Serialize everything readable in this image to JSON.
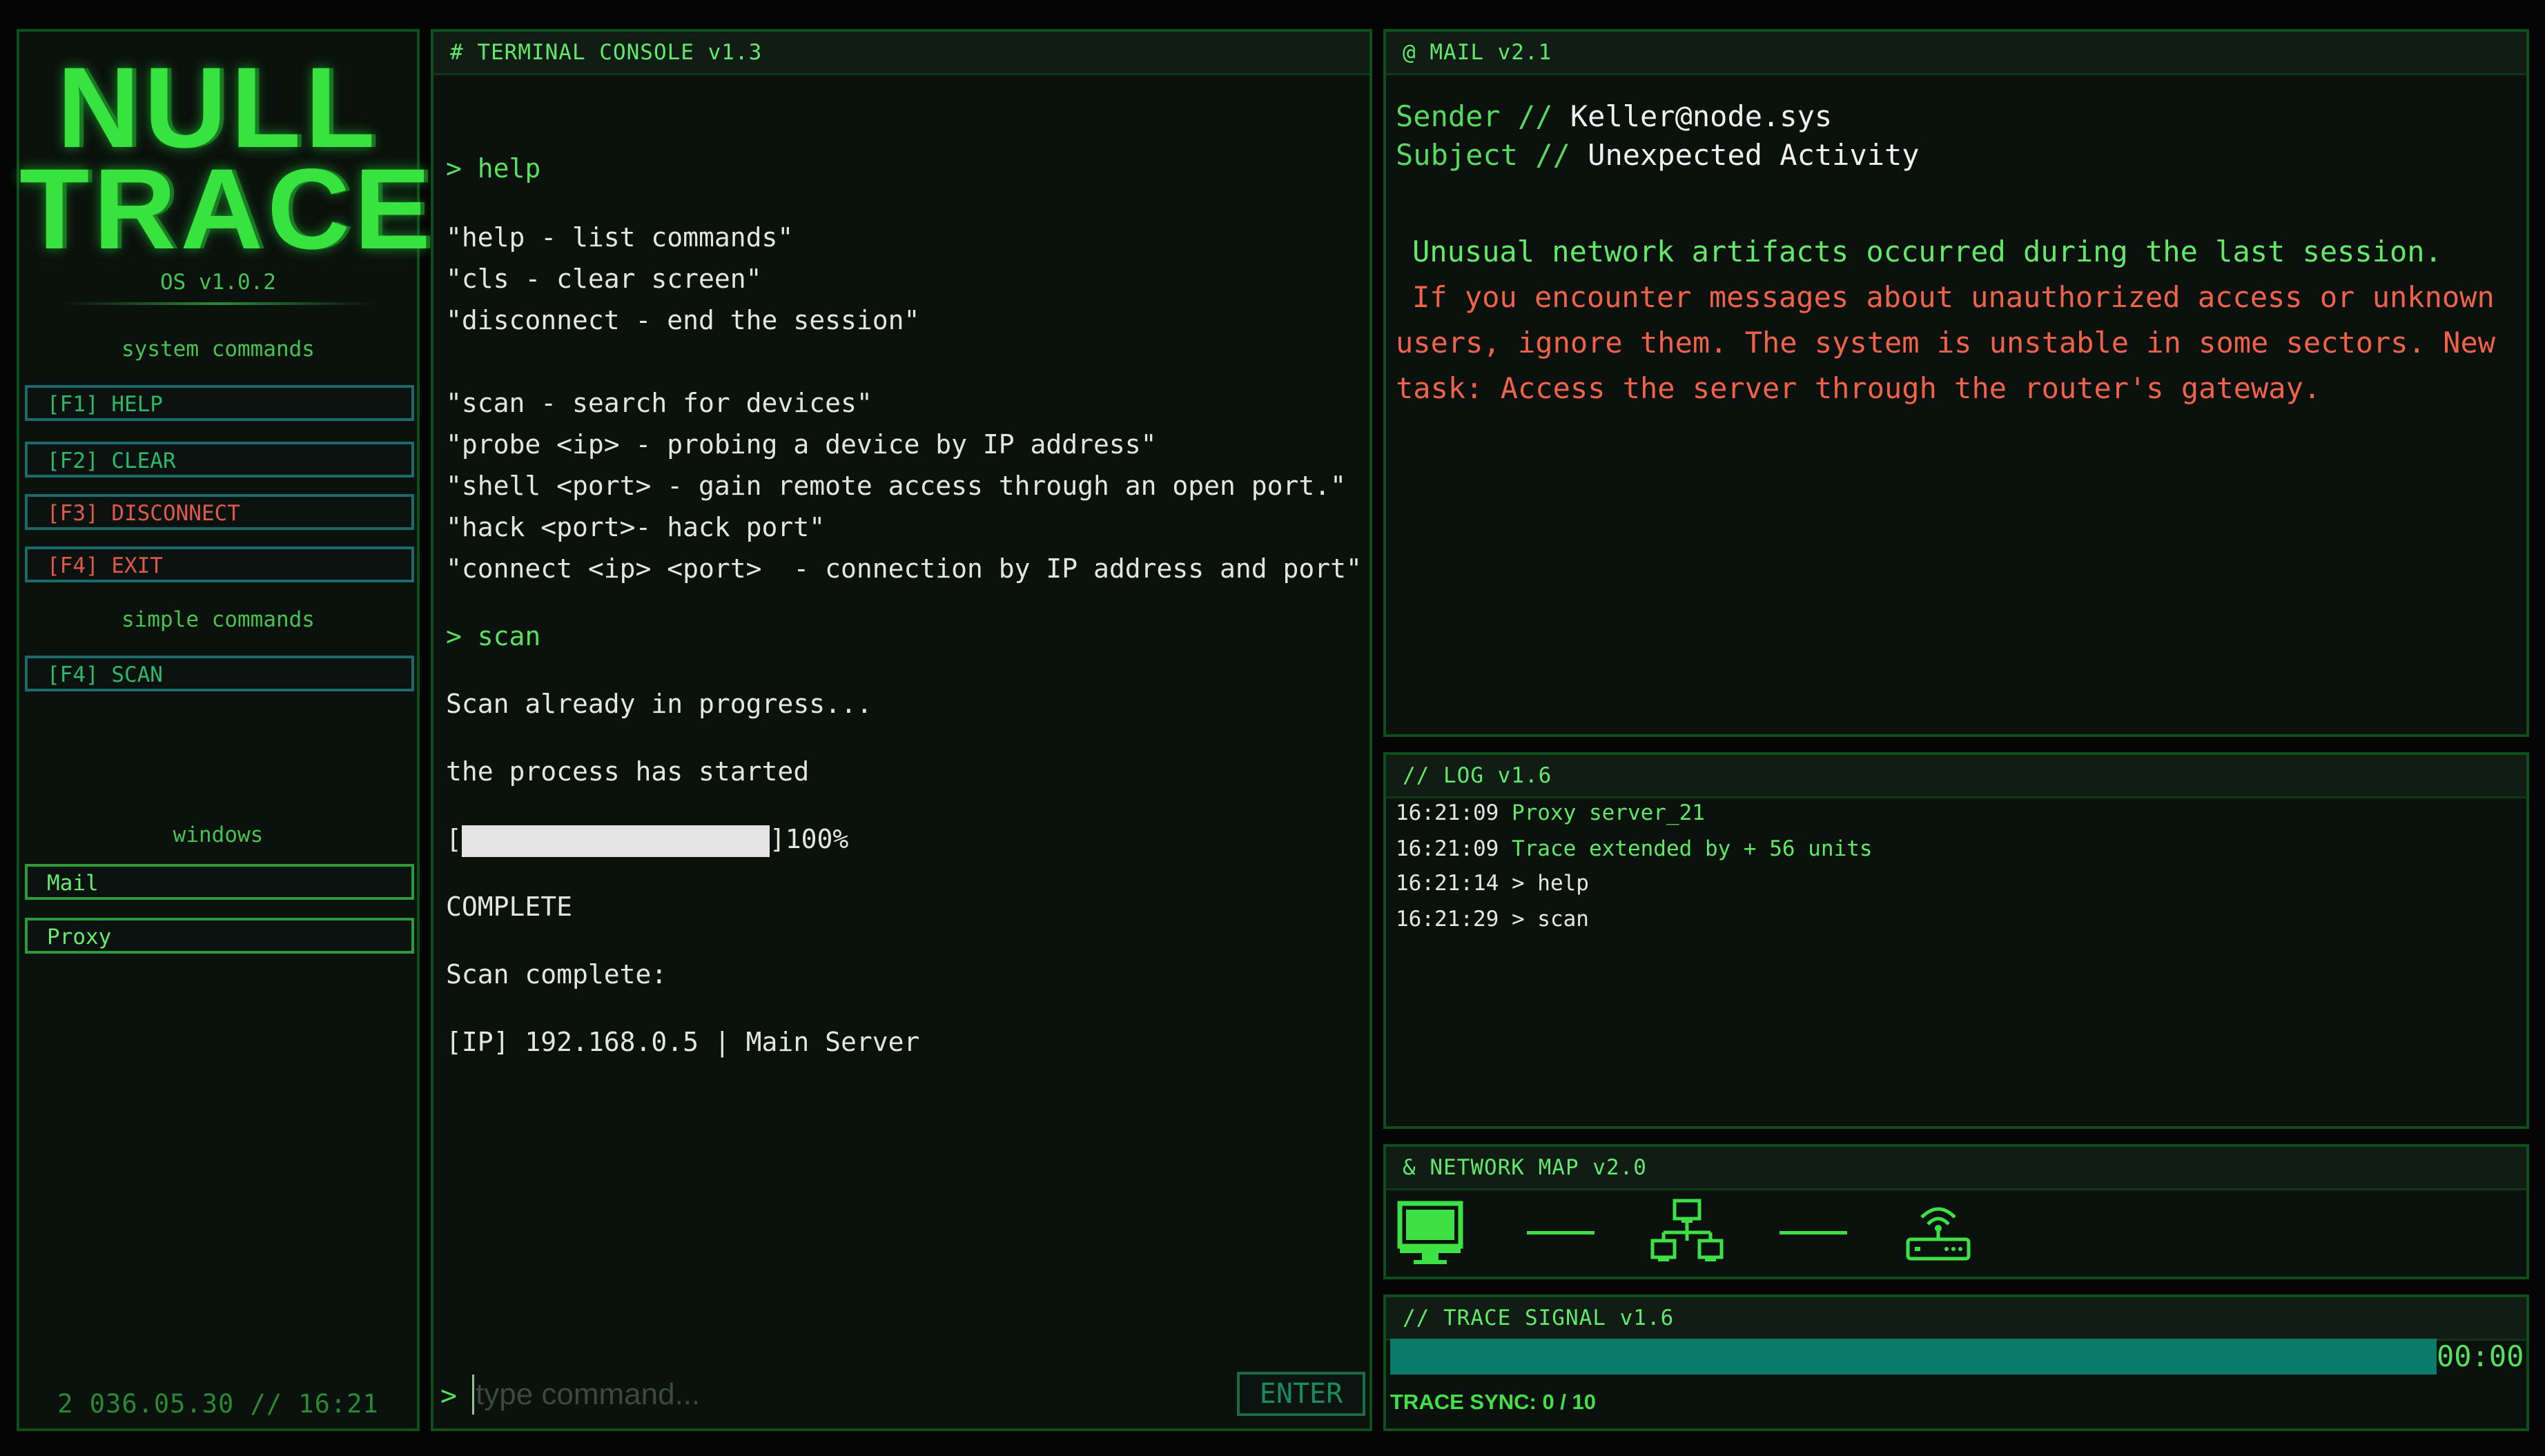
{
  "sidebar": {
    "logo_line1": "NULL",
    "logo_line2": "TRACE",
    "os_version": "OS v1.0.2",
    "system_commands_label": "system commands",
    "system_commands": [
      {
        "label": "[F1] HELP"
      },
      {
        "label": "[F2] CLEAR"
      },
      {
        "label": "[F3] DISCONNECT"
      },
      {
        "label": "[F4] EXIT"
      }
    ],
    "simple_commands_label": "simple commands",
    "simple_commands": [
      {
        "label": "[F4] SCAN"
      }
    ],
    "windows_label": "windows",
    "windows": [
      {
        "label": "Mail"
      },
      {
        "label": "Proxy"
      }
    ],
    "clock": "2 036.05.30 // 16:21"
  },
  "terminal": {
    "title": "# TERMINAL CONSOLE v1.3",
    "lines": [
      "> help",
      "\"help - list commands\"",
      "\"cls - clear screen\"",
      "\"disconnect - end the session\"",
      "\"scan - search for devices\"",
      "\"probe <ip> - probing a device by IP address\"",
      "\"shell <port> - gain remote access through an open port.\"",
      "\"hack <port>- hack port\"",
      "\"connect <ip> <port>  - connection by IP address and port\"",
      "> scan",
      "Scan already in progress...",
      "the process has started",
      "COMPLETE",
      "Scan complete:",
      "[IP] 192.168.0.5 | Main Server"
    ],
    "progress": {
      "open": "[",
      "close": "]100%",
      "value": 100
    },
    "input_prompt": ">",
    "input_placeholder": "type command...",
    "input_value": "",
    "enter_label": "ENTER"
  },
  "mail": {
    "title": "@ MAIL v2.1",
    "sender_label": "Sender // ",
    "sender": "Keller@node.sys",
    "subject_label": "Subject // ",
    "subject": "Unexpected Activity",
    "body_green": "Unusual network artifacts occurred during the last session.",
    "body_red_1": "If you encounter messages about unauthorized access or unknown",
    "body_red_2": "users, ignore them. The system is unstable in some sectors. New",
    "body_red_3": "task: Access the server through the router's gateway."
  },
  "log": {
    "title": "// LOG v1.6",
    "entries": [
      {
        "time": "16:21:09",
        "text": "Proxy server_21"
      },
      {
        "time": "16:21:09",
        "text": "Trace extended by + 56 units"
      },
      {
        "time": "16:21:14",
        "text": "> help"
      },
      {
        "time": "16:21:29",
        "text": "> scan"
      }
    ]
  },
  "network_map": {
    "title": "& NETWORK MAP v2.0",
    "nodes": [
      "monitor-icon",
      "network-hub-icon",
      "router-icon"
    ],
    "color": "#3de146"
  },
  "trace": {
    "title": "// TRACE SIGNAL v1.6",
    "time": "00:00",
    "sync_label": "TRACE SYNC: ",
    "sync_value": "0 / 10",
    "bar_color": "#0d7b6a"
  }
}
